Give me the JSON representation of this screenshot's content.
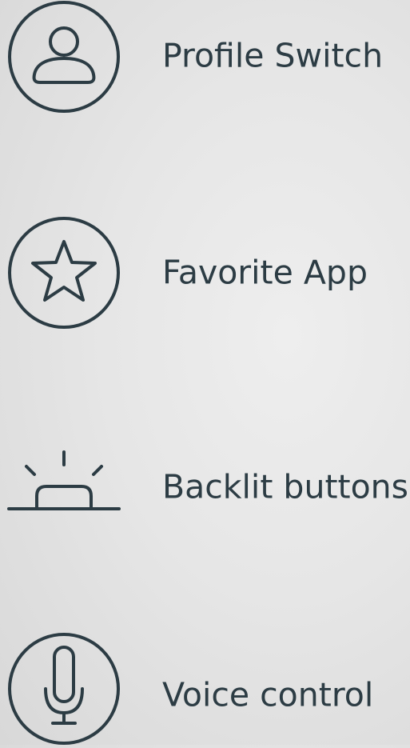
{
  "colors": {
    "icon_stroke": "#2c3c44",
    "text": "#2c3c44",
    "background": "#e6e6e6"
  },
  "features": [
    {
      "icon": "user-icon",
      "label": "Profile Switch"
    },
    {
      "icon": "star-icon",
      "label": "Favorite App"
    },
    {
      "icon": "backlight-icon",
      "label": "Backlit buttons"
    },
    {
      "icon": "microphone-icon",
      "label": "Voice control"
    }
  ]
}
